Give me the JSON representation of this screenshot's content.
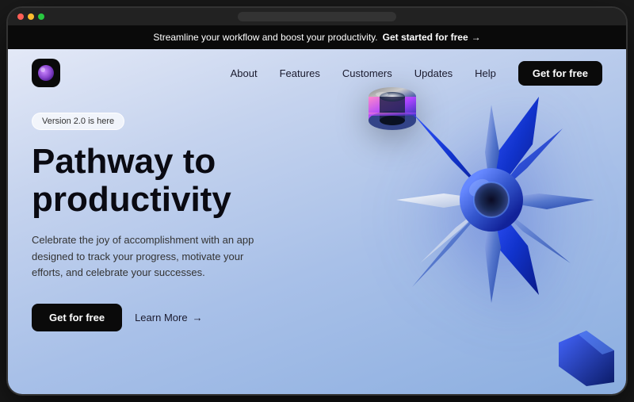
{
  "announcement": {
    "text": "Streamline your workflow and boost your productivity.",
    "cta_label": "Get started for free",
    "cta_arrow": "→"
  },
  "nav": {
    "logo_alt": "App logo",
    "links": [
      {
        "label": "About",
        "id": "about"
      },
      {
        "label": "Features",
        "id": "features"
      },
      {
        "label": "Customers",
        "id": "customers"
      },
      {
        "label": "Updates",
        "id": "updates"
      },
      {
        "label": "Help",
        "id": "help"
      }
    ],
    "cta_label": "Get for free"
  },
  "hero": {
    "badge": "Version 2.0 is here",
    "title_line1": "Pathway to",
    "title_line2": "productivity",
    "subtitle": "Celebrate the joy of accomplishment with an app designed to track your progress, motivate your efforts, and celebrate your successes.",
    "primary_cta": "Get for free",
    "secondary_cta": "Learn More",
    "secondary_arrow": "→"
  },
  "colors": {
    "accent_blue": "#2244dd",
    "bg_gradient_start": "#e8ecf8",
    "bg_gradient_end": "#8baee0",
    "dark": "#0a0a0a"
  }
}
